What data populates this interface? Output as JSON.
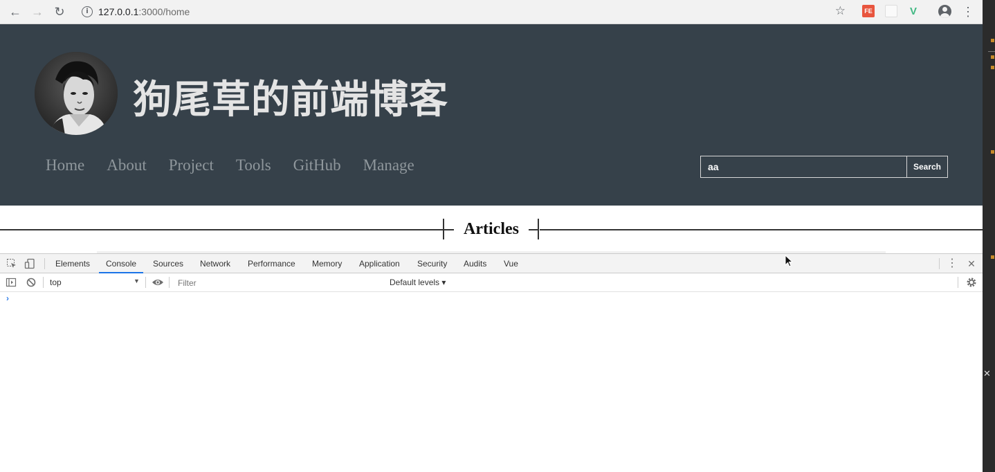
{
  "browser": {
    "url_host": "127.0.0.1",
    "url_path": ":3000/home",
    "ext_fe_label": "FE"
  },
  "site": {
    "title": "狗尾草的前端博客",
    "nav": [
      "Home",
      "About",
      "Project",
      "Tools",
      "GitHub",
      "Manage"
    ],
    "search": {
      "value": "aa",
      "button_label": "Search"
    },
    "section_title": "Articles",
    "colors": {
      "header_bg": "#36414a",
      "title_text": "#e4e4e4",
      "nav_text": "#8f979c"
    }
  },
  "devtools": {
    "tabs": [
      "Elements",
      "Console",
      "Sources",
      "Network",
      "Performance",
      "Memory",
      "Application",
      "Security",
      "Audits",
      "Vue"
    ],
    "active_tab": "Console",
    "context": "top",
    "filter_placeholder": "Filter",
    "levels_label": "Default levels ▾",
    "prompt": "›",
    "accent": "#1a73e8"
  }
}
